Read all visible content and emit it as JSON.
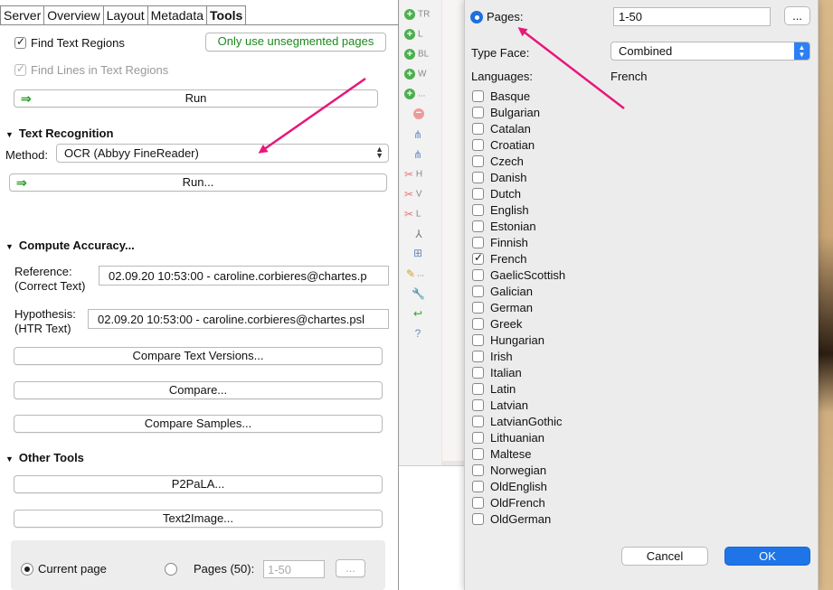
{
  "tabs": [
    {
      "label": "Server"
    },
    {
      "label": "Overview"
    },
    {
      "label": "Layout"
    },
    {
      "label": "Metadata"
    },
    {
      "label": "Tools"
    }
  ],
  "layout_analysis": {
    "find_text_regions": "Find Text Regions",
    "find_lines": "Find Lines in Text Regions",
    "unsegmented_button": "Only use unsegmented pages",
    "run_button": "Run"
  },
  "text_recognition": {
    "title": "Text Recognition",
    "method_label": "Method:",
    "method_value": "OCR (Abbyy FineReader)",
    "run_button": "Run..."
  },
  "compute_accuracy": {
    "title": "Compute Accuracy...",
    "reference_label_1": "Reference:",
    "reference_label_2": "(Correct Text)",
    "reference_value": "02.09.20 10:53:00 - caroline.corbieres@chartes.p",
    "hypothesis_label_1": "Hypothesis:",
    "hypothesis_label_2": "(HTR Text)",
    "hypothesis_value": "02.09.20 10:53:00 - caroline.corbieres@chartes.psl",
    "compare_versions_button": "Compare Text Versions...",
    "compare_button": "Compare...",
    "compare_samples_button": "Compare Samples..."
  },
  "other_tools": {
    "title": "Other Tools",
    "p2pala_button": "P2PaLA...",
    "text2image_button": "Text2Image..."
  },
  "page_scope": {
    "current_page": "Current page",
    "pages_label": "Pages (50):",
    "pages_value": "1-50",
    "browse_button": "..."
  },
  "toolbar": {
    "items": [
      "TR",
      "L",
      "BL",
      "W",
      "...",
      "H",
      "V",
      "L",
      "..."
    ]
  },
  "dialog": {
    "pages_label": "Pages:",
    "pages_value": "1-50",
    "browse_button": "...",
    "typeface_label": "Type Face:",
    "typeface_value": "Combined",
    "languages_label": "Languages:",
    "languages_value": "French",
    "languages": [
      {
        "name": "Basque",
        "checked": false
      },
      {
        "name": "Bulgarian",
        "checked": false
      },
      {
        "name": "Catalan",
        "checked": false
      },
      {
        "name": "Croatian",
        "checked": false
      },
      {
        "name": "Czech",
        "checked": false
      },
      {
        "name": "Danish",
        "checked": false
      },
      {
        "name": "Dutch",
        "checked": false
      },
      {
        "name": "English",
        "checked": false
      },
      {
        "name": "Estonian",
        "checked": false
      },
      {
        "name": "Finnish",
        "checked": false
      },
      {
        "name": "French",
        "checked": true
      },
      {
        "name": "GaelicScottish",
        "checked": false
      },
      {
        "name": "Galician",
        "checked": false
      },
      {
        "name": "German",
        "checked": false
      },
      {
        "name": "Greek",
        "checked": false
      },
      {
        "name": "Hungarian",
        "checked": false
      },
      {
        "name": "Irish",
        "checked": false
      },
      {
        "name": "Italian",
        "checked": false
      },
      {
        "name": "Latin",
        "checked": false
      },
      {
        "name": "Latvian",
        "checked": false
      },
      {
        "name": "LatvianGothic",
        "checked": false
      },
      {
        "name": "Lithuanian",
        "checked": false
      },
      {
        "name": "Maltese",
        "checked": false
      },
      {
        "name": "Norwegian",
        "checked": false
      },
      {
        "name": "OldEnglish",
        "checked": false
      },
      {
        "name": "OldFrench",
        "checked": false
      },
      {
        "name": "OldGerman",
        "checked": false
      }
    ],
    "cancel_button": "Cancel",
    "ok_button": "OK"
  },
  "colors": {
    "accent": "#1f74e8",
    "annotation_arrow": "#e8177a",
    "green": "#2ea22e"
  }
}
